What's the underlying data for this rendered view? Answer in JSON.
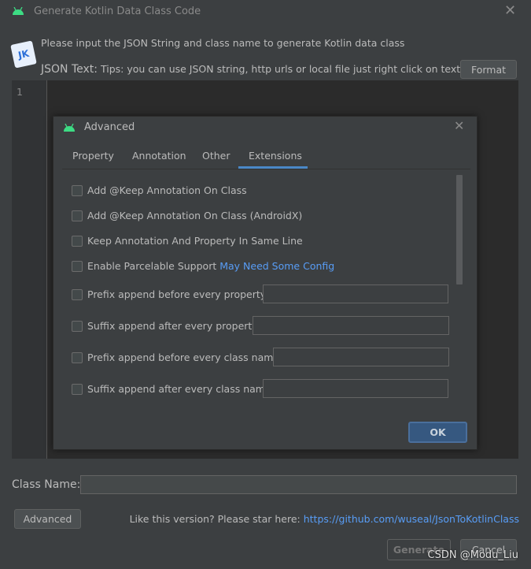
{
  "window": {
    "title": "Generate Kotlin Data Class Code"
  },
  "header": {
    "description": "Please input the JSON String and class name to generate Kotlin data class",
    "json_label": "JSON Text:",
    "tips": "Tips: you can use JSON string, http urls or local file just right click on text area",
    "format_label": "Format",
    "logo_text": "JK"
  },
  "editor": {
    "line_numbers": [
      "1"
    ],
    "content": ""
  },
  "advanced_dialog": {
    "title": "Advanced",
    "tabs": [
      {
        "label": "Property",
        "active": false
      },
      {
        "label": "Annotation",
        "active": false
      },
      {
        "label": "Other",
        "active": false
      },
      {
        "label": "Extensions",
        "active": true
      }
    ],
    "options": [
      {
        "label": "Add @Keep Annotation On Class",
        "checked": false
      },
      {
        "label": "Add @Keep Annotation On Class (AndroidX)",
        "checked": false
      },
      {
        "label": "Keep Annotation And Property In Same Line",
        "checked": false
      },
      {
        "label": "Enable Parcelable Support",
        "link": "May Need Some Config",
        "checked": false
      },
      {
        "label": "Prefix append before every property:",
        "checked": false,
        "value": ""
      },
      {
        "label": "Suffix append after every property:",
        "checked": false,
        "value": ""
      },
      {
        "label": "Prefix append before every class name:",
        "checked": false,
        "value": ""
      },
      {
        "label": "Suffix append after every class name:",
        "checked": false,
        "value": ""
      }
    ],
    "ok_label": "OK"
  },
  "footer": {
    "class_name_label": "Class Name:",
    "class_name_value": "",
    "advanced_label": "Advanced",
    "star_text": "Like this version? Please star here:",
    "star_link": "https://github.com/wuseal/JsonToKotlinClass",
    "generate_label": "Generate",
    "cancel_label": "Cancel"
  },
  "watermark": "CSDN @Modu_Liu",
  "colors": {
    "accent": "#4a88c7",
    "link": "#589df6",
    "android": "#3ddc84",
    "background": "#3c3f41",
    "editor": "#2b2b2b"
  }
}
